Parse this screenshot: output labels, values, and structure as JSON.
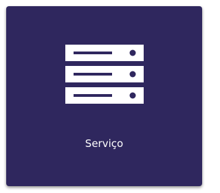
{
  "tile": {
    "label": "Serviço",
    "icon": "server-icon",
    "background": "#2f275e"
  }
}
